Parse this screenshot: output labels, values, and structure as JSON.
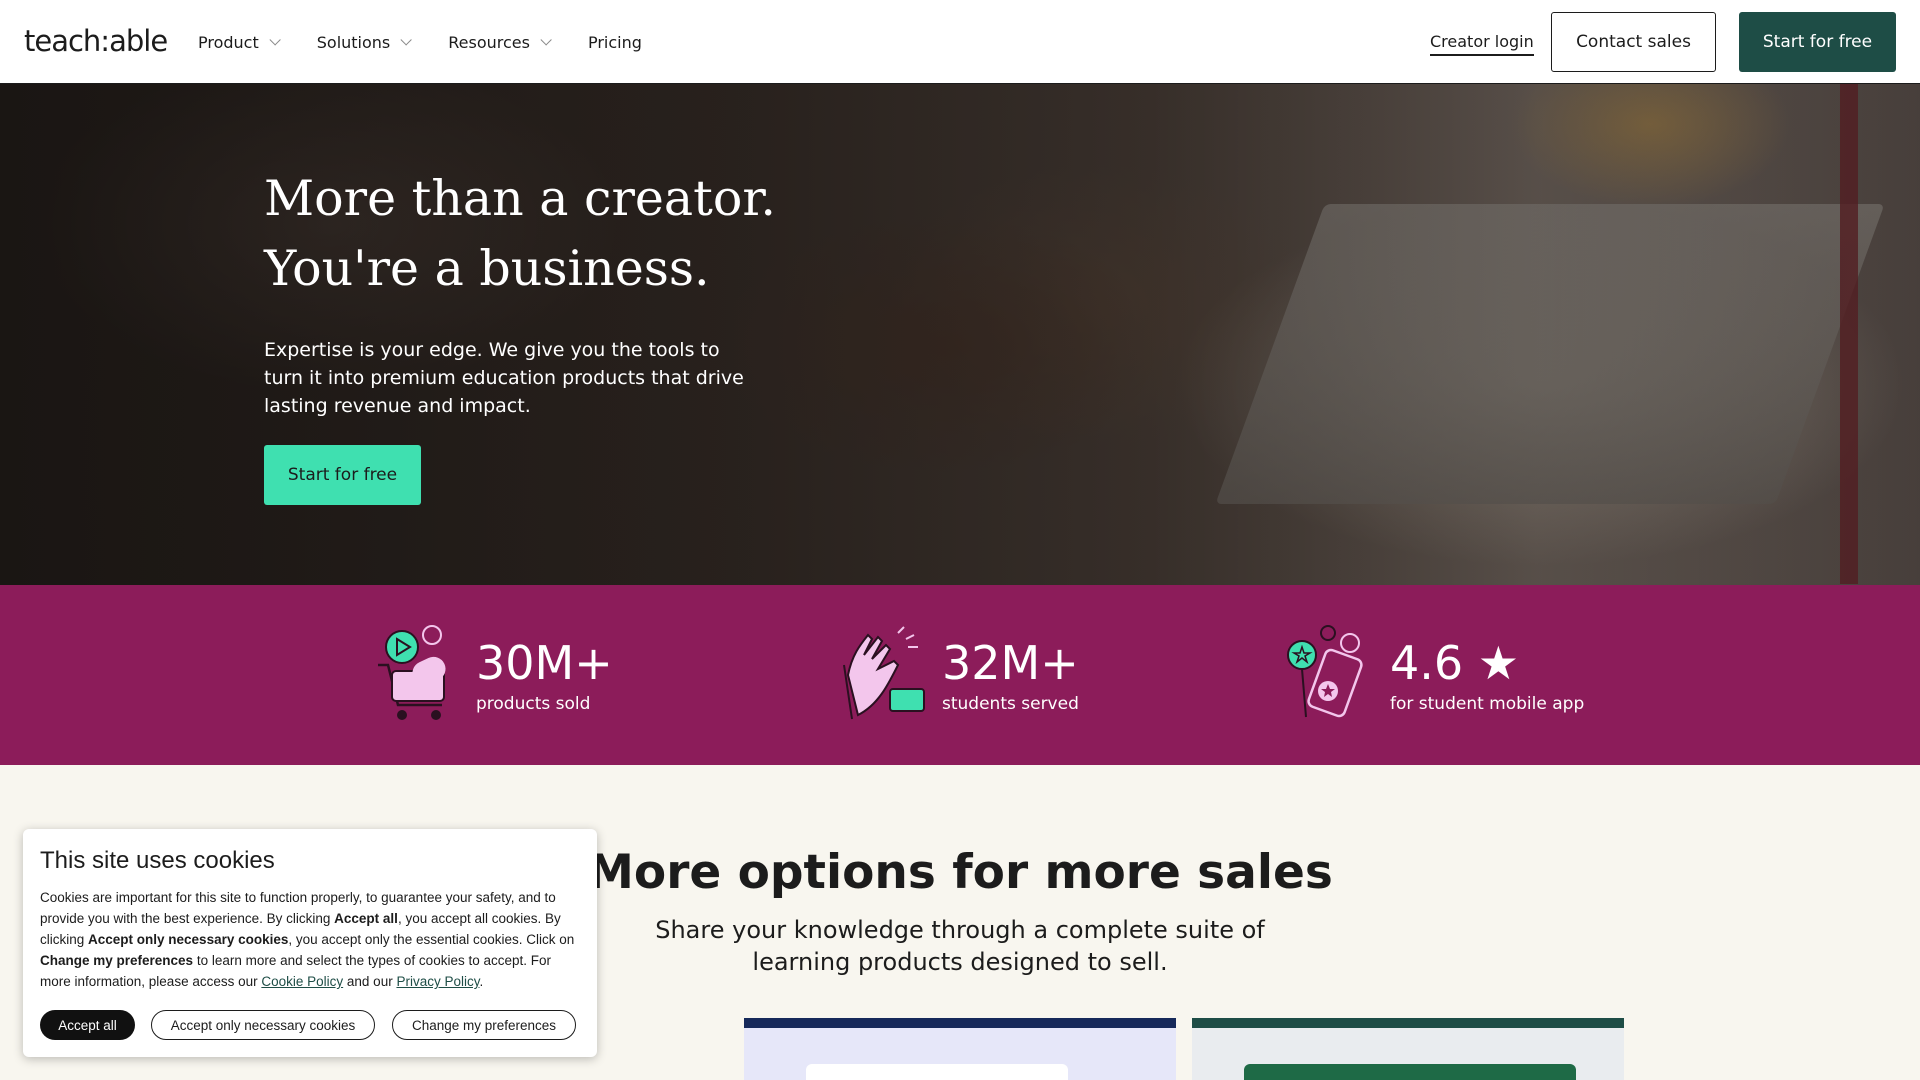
{
  "nav": {
    "logo": "teach:able",
    "items": [
      {
        "label": "Product",
        "dropdown": true
      },
      {
        "label": "Solutions",
        "dropdown": true
      },
      {
        "label": "Resources",
        "dropdown": true
      },
      {
        "label": "Pricing",
        "dropdown": false
      }
    ],
    "creator_login": "Creator login",
    "contact_sales": "Contact sales",
    "start_free": "Start for free"
  },
  "hero": {
    "title_line1": "More than a creator.",
    "title_line2": "You're a business.",
    "subtitle": "Expertise is your edge. We give you the tools to turn it into premium education products that drive lasting revenue and impact.",
    "cta": "Start for free"
  },
  "stats": [
    {
      "value": "30M+",
      "label": "products sold",
      "icon": "shopping-cart-icon"
    },
    {
      "value": "32M+",
      "label": "students served",
      "icon": "high-five-icon"
    },
    {
      "value": "4.6 ★",
      "label": "for student mobile app",
      "icon": "phone-stars-icon"
    }
  ],
  "section": {
    "title": "More options for more sales",
    "subtitle": "Share your knowledge through a complete suite of learning products designed to sell."
  },
  "cookie": {
    "title": "This site uses cookies",
    "body_1": "Cookies are important for this site to function properly, to guarantee your safety, and to provide you with the best experience. By clicking ",
    "accept_all_bold": "Accept all",
    "body_2": ", you accept all cookies. By clicking ",
    "necessary_bold": "Accept only necessary cookies",
    "body_3": ", you accept only the essential cookies. Click on ",
    "prefs_bold": "Change my preferences",
    "body_4": " to learn more and select the types of cookies to accept. For more information, please access our ",
    "cookie_policy": "Cookie Policy",
    "body_5": " and our ",
    "privacy_policy": "Privacy Policy",
    "body_6": ".",
    "btn_accept": "Accept all",
    "btn_necessary": "Accept only necessary cookies",
    "btn_prefs": "Change my preferences"
  },
  "colors": {
    "brand_dark_green": "#1e4d46",
    "hero_cta": "#3fe0b0",
    "stats_bg": "#8c1c5a",
    "page_bg": "#f8f6ef"
  }
}
